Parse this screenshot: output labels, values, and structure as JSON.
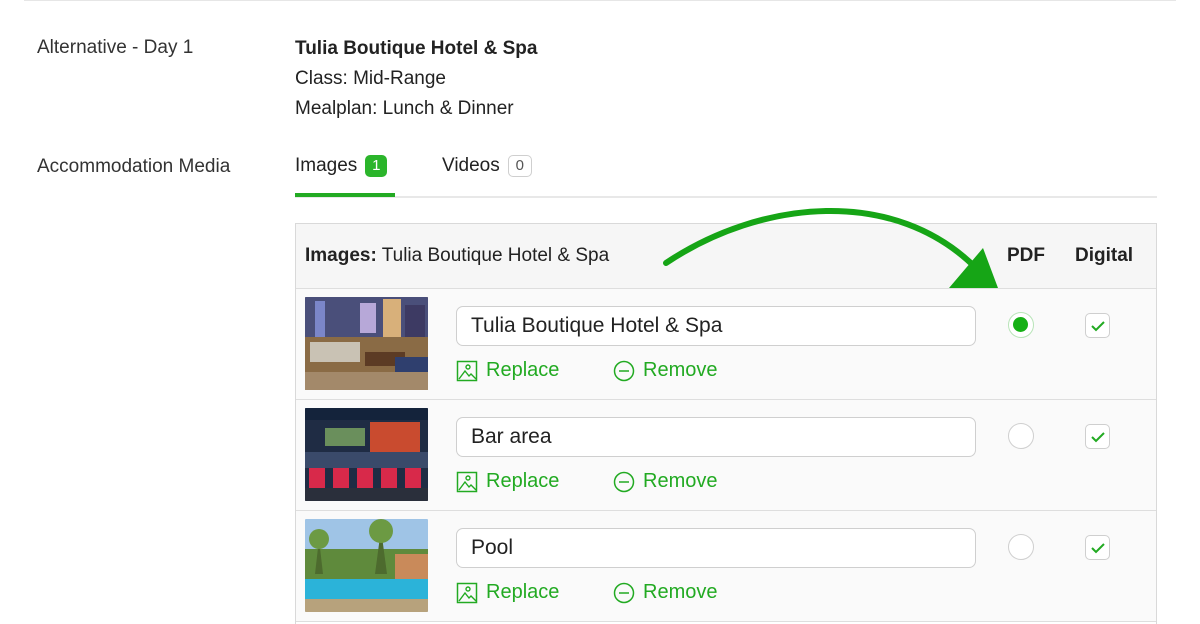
{
  "details": {
    "alt_label": "Alternative - Day 1",
    "hotel_name": "Tulia Boutique Hotel & Spa",
    "class_line": "Class: Mid-Range",
    "mealplan_line": "Mealplan: Lunch & Dinner"
  },
  "media": {
    "label": "Accommodation Media",
    "tabs": [
      {
        "label": "Images",
        "count": "1",
        "active": true
      },
      {
        "label": "Videos",
        "count": "0",
        "active": false
      }
    ]
  },
  "table": {
    "title_bold": "Images:",
    "title_rest": " Tulia Boutique Hotel & Spa",
    "col_pdf": "PDF",
    "col_digital": "Digital",
    "replace_label": "Replace",
    "remove_label": "Remove",
    "rows": [
      {
        "caption": "Tulia Boutique Hotel & Spa",
        "pdf_selected": true,
        "digital_checked": true
      },
      {
        "caption": "Bar area",
        "pdf_selected": false,
        "digital_checked": true
      },
      {
        "caption": "Pool",
        "pdf_selected": false,
        "digital_checked": true
      }
    ]
  },
  "colors": {
    "accent": "#22aa22",
    "arrow": "#16a516"
  },
  "icons": [
    "image-icon",
    "minus-circle-icon",
    "check-icon",
    "arrow-annotation"
  ]
}
